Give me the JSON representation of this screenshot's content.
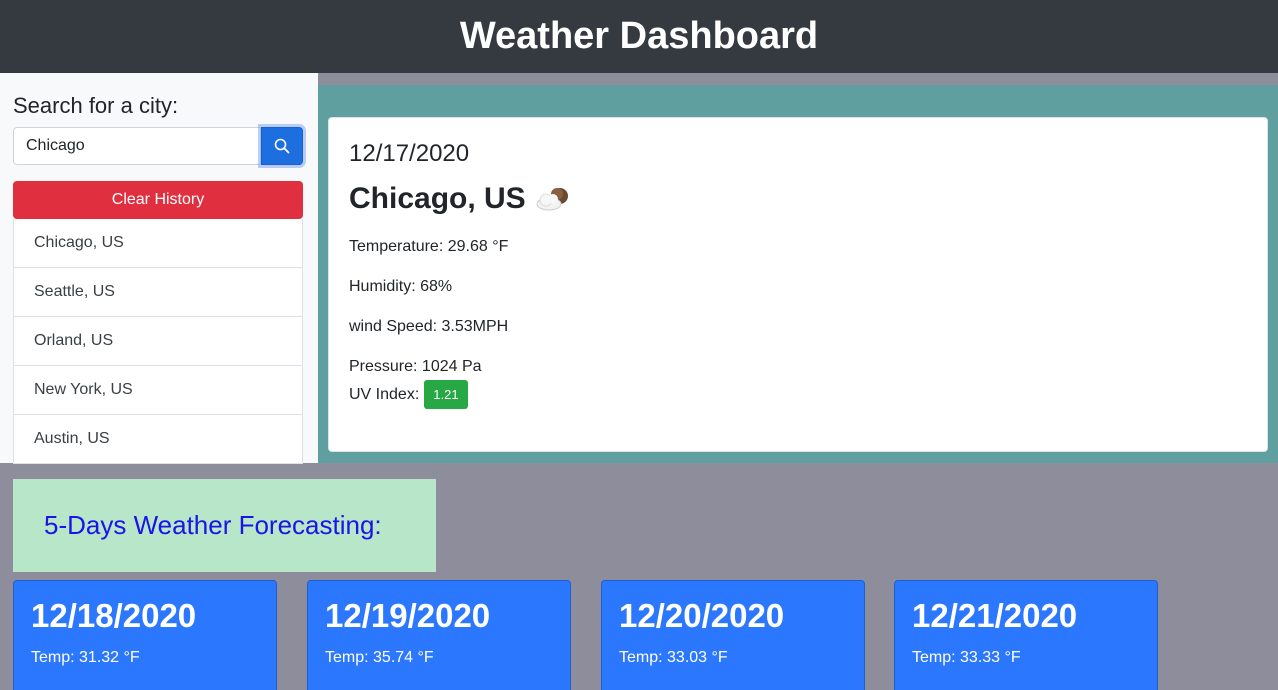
{
  "header": {
    "title": "Weather Dashboard"
  },
  "sidebar": {
    "heading": "Search for a city:",
    "search_value": "Chicago",
    "clear_label": "Clear History",
    "history": [
      "Chicago, US",
      "Seattle, US",
      "Orland, US",
      "New York, US",
      "Austin, US"
    ]
  },
  "current": {
    "date": "12/17/2020",
    "city": "Chicago, US",
    "weather_icon": "partly-cloudy-night-icon",
    "temperature": "Temperature: 29.68 °F",
    "humidity": "Humidity: 68%",
    "wind": "wind Speed: 3.53MPH",
    "pressure": "Pressure: 1024 Pa",
    "uv_label": "UV Index:",
    "uv_value": "1.21",
    "uv_color": "#28a745"
  },
  "forecast": {
    "title": "5-Days Weather Forecasting:",
    "days": [
      {
        "date": "12/18/2020",
        "temp": "Temp: 31.32 °F"
      },
      {
        "date": "12/19/2020",
        "temp": "Temp: 35.74 °F"
      },
      {
        "date": "12/20/2020",
        "temp": "Temp: 33.03 °F"
      },
      {
        "date": "12/21/2020",
        "temp": "Temp: 33.33 °F"
      }
    ]
  },
  "colors": {
    "header_bg": "#343a40",
    "current_bg": "#5f9fa0",
    "forecast_card": "#2b78ff",
    "clear_button": "#e0303f",
    "search_button": "#1d6fe0"
  }
}
